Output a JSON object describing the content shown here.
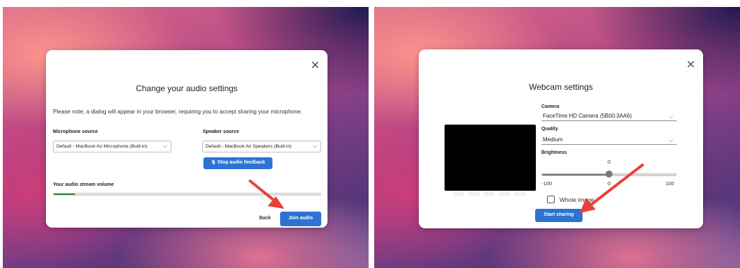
{
  "audio_dialog": {
    "title": "Change your audio settings",
    "close_glyph": "✕",
    "note": "Please note, a dialog will appear in your browser, requiring you to accept sharing your microphone.",
    "microphone": {
      "label": "Microphone source",
      "value": "Default - MacBook Air Microphone (Built-in)"
    },
    "speaker": {
      "label": "Speaker source",
      "value": "Default - MacBook Air Speakers (Built-in)"
    },
    "stop_feedback_label": "Stop audio feedback",
    "volume": {
      "label": "Your audio stream volume",
      "level": 0.08
    },
    "back_label": "Back",
    "join_label": "Join audio"
  },
  "webcam_dialog": {
    "title": "Webcam settings",
    "close_glyph": "✕",
    "camera": {
      "label": "Camera",
      "value": "FaceTime HD Camera (5B00:3AA6)"
    },
    "quality": {
      "label": "Quality",
      "value": "Medium"
    },
    "brightness": {
      "label": "Brightness",
      "value": "0",
      "min_label": "-100",
      "mid_label": "0",
      "max_label": "100",
      "level": 0.5
    },
    "whole_image_label": "Whole image",
    "start_label": "Start sharing"
  },
  "icons": {
    "chevron": "⌵",
    "mic": "🎙"
  },
  "colors": {
    "primary": "#2c73d2",
    "volume": "#2e8b3a",
    "annotation_arrow": "#e8413a"
  }
}
